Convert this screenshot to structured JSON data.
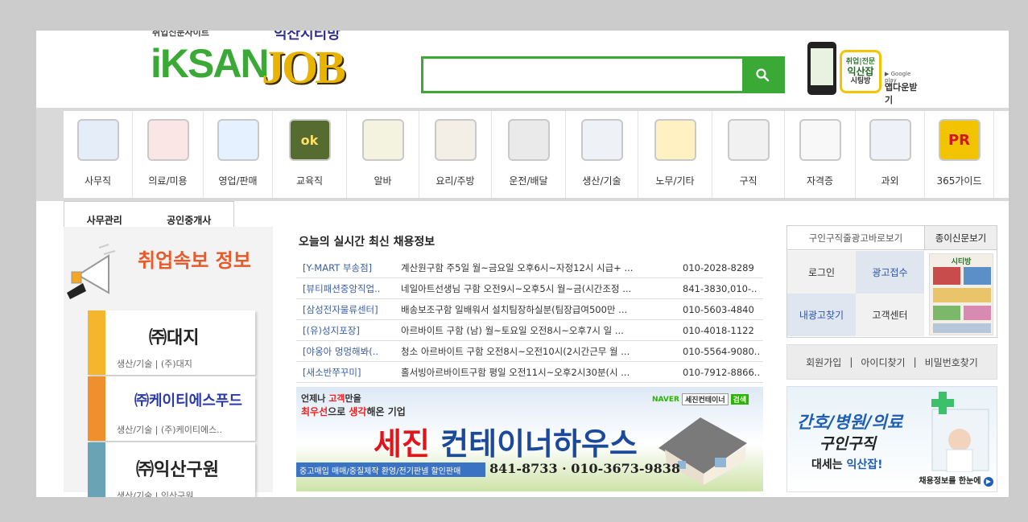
{
  "header": {
    "logo_tag_small": "취업신문사이트",
    "logo_tag_right": "익산시티방",
    "logo_iksan": "iKSAN",
    "logo_job": "JOB",
    "search": {
      "value": "",
      "placeholder": ""
    },
    "app": {
      "logo_text_1": "취업|전문",
      "logo_text_2": "익산잡",
      "logo_text_3": "시팅방",
      "google_play": "Google play",
      "download_label": "앱다운받기"
    }
  },
  "nav": {
    "items": [
      {
        "label": "사무직",
        "icon": "monitor-chart-icon"
      },
      {
        "label": "의료/미용",
        "icon": "medical-clipboard-icon"
      },
      {
        "label": "영업/판매",
        "icon": "sales-growth-icon"
      },
      {
        "label": "교육직",
        "icon": "chalkboard-icon"
      },
      {
        "label": "알바",
        "icon": "alarm-clock-icon"
      },
      {
        "label": "요리/주방",
        "icon": "fork-spoon-icon"
      },
      {
        "label": "운전/배달",
        "icon": "tire-icon"
      },
      {
        "label": "생산/기술",
        "icon": "tools-icon"
      },
      {
        "label": "노무/기타",
        "icon": "barricade-icon"
      },
      {
        "label": "구직",
        "icon": "checkbox-icon"
      },
      {
        "label": "자격증",
        "icon": "certificate-icon"
      },
      {
        "label": "과외",
        "icon": "tutor-icon"
      },
      {
        "label": "365가이드",
        "icon": "tv-pr-icon"
      }
    ],
    "sub": [
      "사무관리",
      "공인중개사"
    ]
  },
  "news": {
    "title": "취업속보 정보",
    "cards": [
      {
        "name": "㈜대지",
        "sub": "생산/기술 | (주)대지"
      },
      {
        "name": "㈜케이티에스푸드",
        "sub": "생산/기술 | (주)케이티에스.."
      },
      {
        "name": "㈜익산구원",
        "sub": "생산/기술 | 익산구원"
      }
    ]
  },
  "live": {
    "title": "오늘의 실시간 최신 채용정보",
    "rows": [
      {
        "company": "[Y-MART 부송점]",
        "title": "계산원구함 주5일 월~금요일 오후6시~자정12시 시급+ ...",
        "phone": "010-2028-8289"
      },
      {
        "company": "[뷰티패션중앙직업..",
        "title": "네일아트선생님 구함 오전9시~오후5시 월~금(시간조정 ...",
        "phone": "841-3830,010-.."
      },
      {
        "company": "[삼성전자물류센터]",
        "title": "배송보조구함 일배워서 설치팀장하실분(팀장급여500만 ...",
        "phone": "010-5603-4840"
      },
      {
        "company": "[(유)성지포장]",
        "title": "아르바이트 구함 (남) 월~토요일 오전8시~오후7시 일 ...",
        "phone": "010-4018-1122"
      },
      {
        "company": "[야옹아 멍멍해봐(..",
        "title": "청소 아르바이트 구함 오전8시~오전10시(2시간근무 월 ...",
        "phone": "010-5564-9080.."
      },
      {
        "company": "[새소반쭈꾸미]",
        "title": "홀서빙아르바이트구함 평일 오전11시~오후2시30분(시 ...",
        "phone": "010-7912-8866.."
      }
    ]
  },
  "banner": {
    "line1a": "언제나 ",
    "line1b": "고객",
    "line1c": "만을",
    "line2a": "최우선",
    "line2b": "으로 ",
    "line2c": "생각",
    "line2d": "해온 기업",
    "naver": "NAVER",
    "naver_tag": "세진컨테이너",
    "naver_search": "검색",
    "name_red": "세진",
    "name_blue": " 컨테이너하우스",
    "strip": "중고매입 매매/중질제작 환영/전기판넬 할인판매",
    "phones": "841-8733 · 010-3673-9838"
  },
  "right": {
    "tab1": "구인구직줄광고바로보기",
    "tab2": "종이신문보기",
    "cells": [
      "로그인",
      "광고접수",
      "내광고찾기",
      "고객센터"
    ],
    "thumb_title": "시티방",
    "member": [
      "회원가입",
      "아이디찾기",
      "비밀번호찾기"
    ],
    "sep": "|",
    "rbanner": {
      "line1": "간호/병원/의료",
      "line2": "구인구직",
      "line3a": "대세는 ",
      "line3b": "익산잡!",
      "foot": "채용정보를 한눈에"
    }
  },
  "colors": {
    "brand_green": "#3aa935",
    "link_blue": "#3a5ea8",
    "accent_orange": "#e85a2a"
  }
}
